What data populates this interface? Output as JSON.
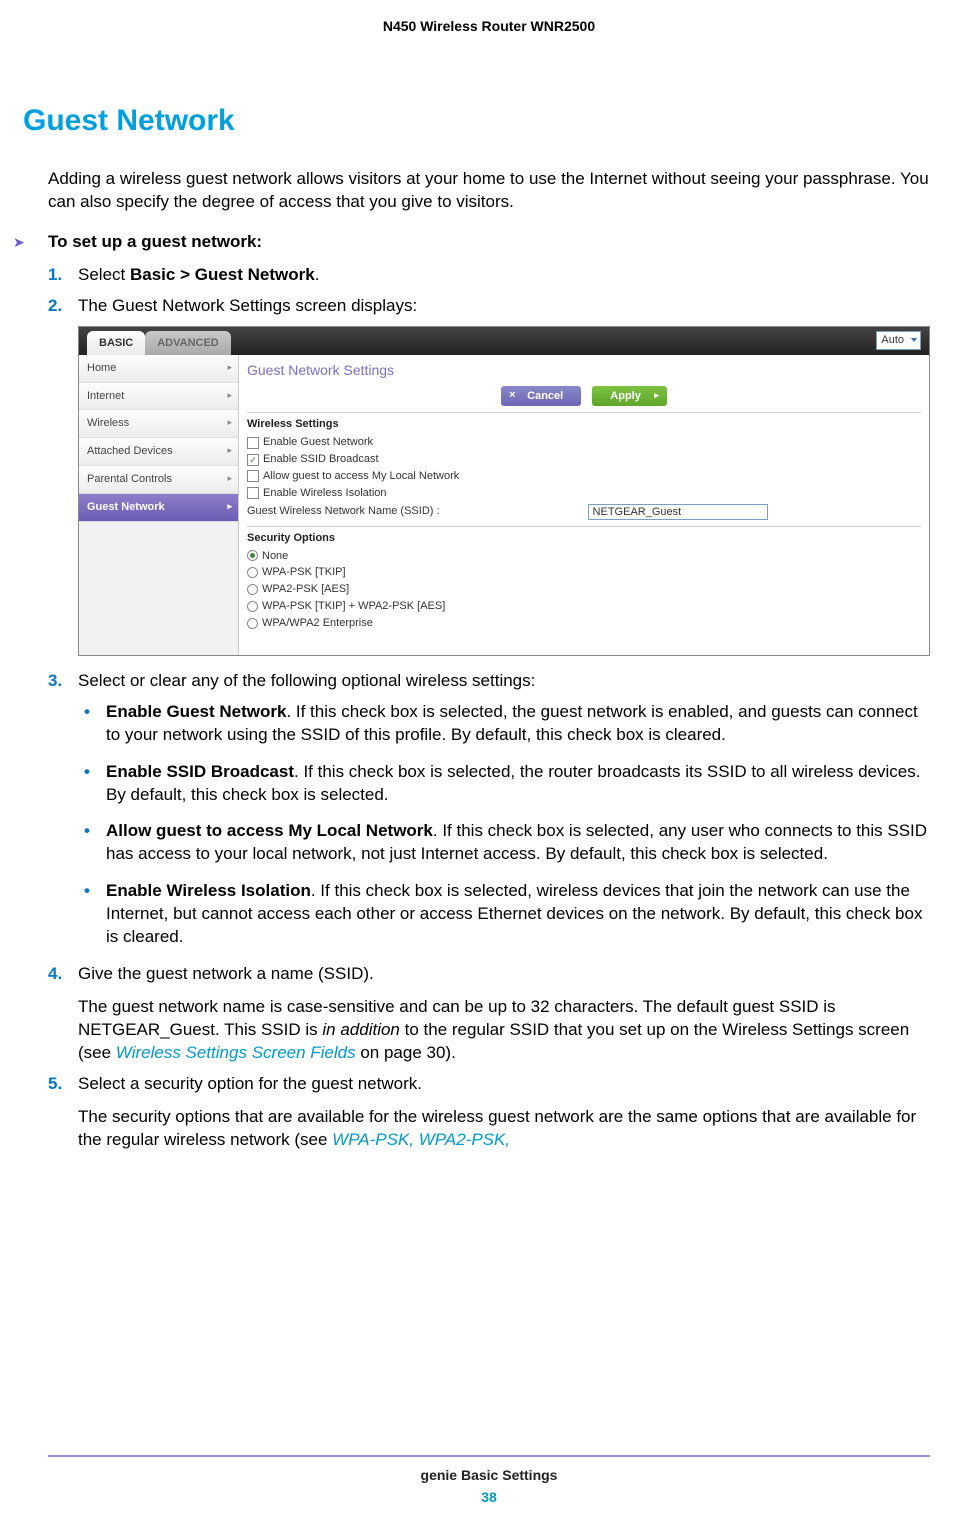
{
  "header": "N450 Wireless Router WNR2500",
  "title": "Guest Network",
  "intro": "Adding a wireless guest network allows visitors at your home to use the Internet without seeing your passphrase. You can also specify the degree of access that you give to visitors.",
  "proc_head": "To set up a guest network:",
  "steps": {
    "s1_pre": "Select ",
    "s1_bold": "Basic > Guest Network",
    "s1_post": ".",
    "s2": "The Guest Network Settings screen displays:",
    "s3": "Select or clear any of the following optional wireless settings:",
    "bullets": [
      {
        "title": "Enable Guest Network",
        "body": ". If this check box is selected, the guest network is enabled, and guests can connect to your network using the SSID of this profile. By default, this check box is cleared."
      },
      {
        "title": "Enable SSID Broadcast",
        "body": ". If this check box is selected, the router broadcasts its SSID to all wireless devices. By default, this check box is selected."
      },
      {
        "title": "Allow guest to access My Local Network",
        "body": ". If this check box is selected, any user who connects to this SSID has access to your local network, not just Internet access. By default, this check box is selected."
      },
      {
        "title": "Enable Wireless Isolation",
        "body": ". If this check box is selected, wireless devices that join the network can use the Internet, but cannot access each other or access Ethernet devices on the network. By default, this check box is cleared."
      }
    ],
    "s4": "Give the guest network a name (SSID).",
    "s4_p_a": "The guest network name is case-sensitive and can be up to 32 characters. The default guest SSID is NETGEAR_Guest. This SSID is ",
    "s4_p_it": "in addition",
    "s4_p_b": " to the regular SSID that you set up on the Wireless Settings screen (see ",
    "s4_link": "Wireless Settings Screen Fields",
    "s4_p_c": " on page 30).",
    "s5": "Select a security option for the guest network.",
    "s5_p_a": "The security options that are available for the wireless guest network are the same options that are available for the regular wireless network (see ",
    "s5_link": "WPA-PSK, WPA2-PSK,"
  },
  "ss": {
    "tabs": {
      "basic": "BASIC",
      "advanced": "ADVANCED"
    },
    "auto": "Auto",
    "sidebar": [
      "Home",
      "Internet",
      "Wireless",
      "Attached Devices",
      "Parental Controls",
      "Guest Network"
    ],
    "panel_title": "Guest Network Settings",
    "cancel": "Cancel",
    "apply": "Apply",
    "sect1": "Wireless Settings",
    "checks": [
      {
        "label": "Enable Guest Network",
        "checked": false
      },
      {
        "label": "Enable SSID Broadcast",
        "checked": true
      },
      {
        "label": "Allow guest to access My Local Network",
        "checked": false
      },
      {
        "label": "Enable Wireless Isolation",
        "checked": false
      }
    ],
    "ssid_label": "Guest Wireless Network Name (SSID) :",
    "ssid_value": "NETGEAR_Guest",
    "sect2": "Security Options",
    "radios": [
      {
        "label": "None",
        "checked": true
      },
      {
        "label": "WPA-PSK [TKIP]",
        "checked": false
      },
      {
        "label": "WPA2-PSK [AES]",
        "checked": false
      },
      {
        "label": "WPA-PSK [TKIP] + WPA2-PSK [AES]",
        "checked": false
      },
      {
        "label": "WPA/WPA2 Enterprise",
        "checked": false
      }
    ]
  },
  "footer": {
    "text": "genie Basic Settings",
    "page": "38"
  }
}
